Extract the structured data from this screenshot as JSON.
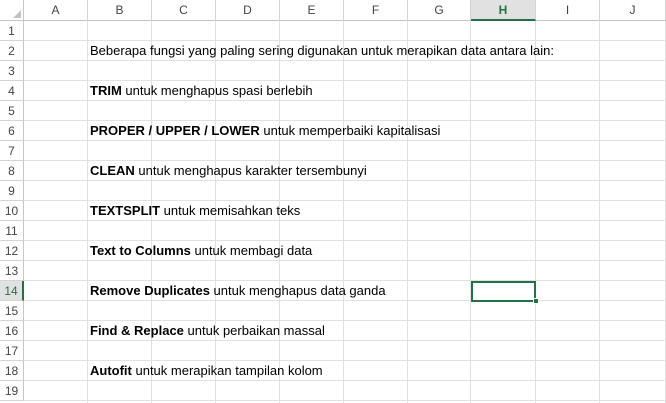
{
  "columns": [
    "A",
    "B",
    "C",
    "D",
    "E",
    "F",
    "G",
    "H",
    "I",
    "J"
  ],
  "rows": [
    "1",
    "2",
    "3",
    "4",
    "5",
    "6",
    "7",
    "8",
    "9",
    "10",
    "11",
    "12",
    "13",
    "14",
    "15",
    "16",
    "17",
    "18",
    "19"
  ],
  "selected_column": "H",
  "selected_row": "14",
  "cells": {
    "intro": "Beberapa fungsi yang paling sering digunakan untuk merapikan data antara lain:",
    "items": [
      {
        "row": "4",
        "bold": "TRIM",
        "rest": " untuk menghapus spasi berlebih"
      },
      {
        "row": "6",
        "bold": "PROPER / UPPER / LOWER",
        "rest": " untuk memperbaiki kapitalisasi"
      },
      {
        "row": "8",
        "bold": "CLEAN",
        "rest": " untuk menghapus karakter tersembunyi"
      },
      {
        "row": "10",
        "bold": "TEXTSPLIT",
        "rest": " untuk memisahkan teks"
      },
      {
        "row": "12",
        "bold": "Text to Columns",
        "rest": " untuk membagi data"
      },
      {
        "row": "14",
        "bold": "Remove Duplicates",
        "rest": " untuk menghapus data ganda"
      },
      {
        "row": "16",
        "bold": "Find & Replace",
        "rest": " untuk perbaikan massal"
      },
      {
        "row": "18",
        "bold": "Autofit",
        "rest": " untuk merapikan tampilan kolom"
      }
    ]
  },
  "colors": {
    "accent": "#217346",
    "grid": "#e1e1e1"
  }
}
